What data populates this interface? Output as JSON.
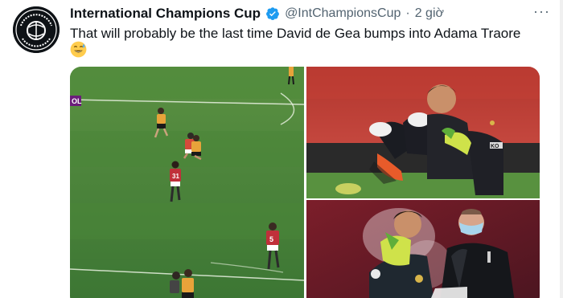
{
  "tweet": {
    "display_name": "International Champions Cup",
    "handle": "@IntChampionsCup",
    "separator": "·",
    "time": "2 giờ",
    "more_label": "···",
    "text": "That will probably be the last time David de Gea bumps into Adama Traore",
    "emoji": "sweat-smile-emoji"
  },
  "media": {
    "photo1": {
      "score_tag": "OL",
      "shirt_numbers": [
        "31",
        "5"
      ]
    },
    "photo2": {
      "badge": "KO"
    },
    "photo3": {}
  },
  "colors": {
    "verified": "#1d9bf0",
    "text": "#0f1419",
    "muted": "#536471",
    "pitch": "#3f7a34",
    "united_red": "#b3262e"
  }
}
